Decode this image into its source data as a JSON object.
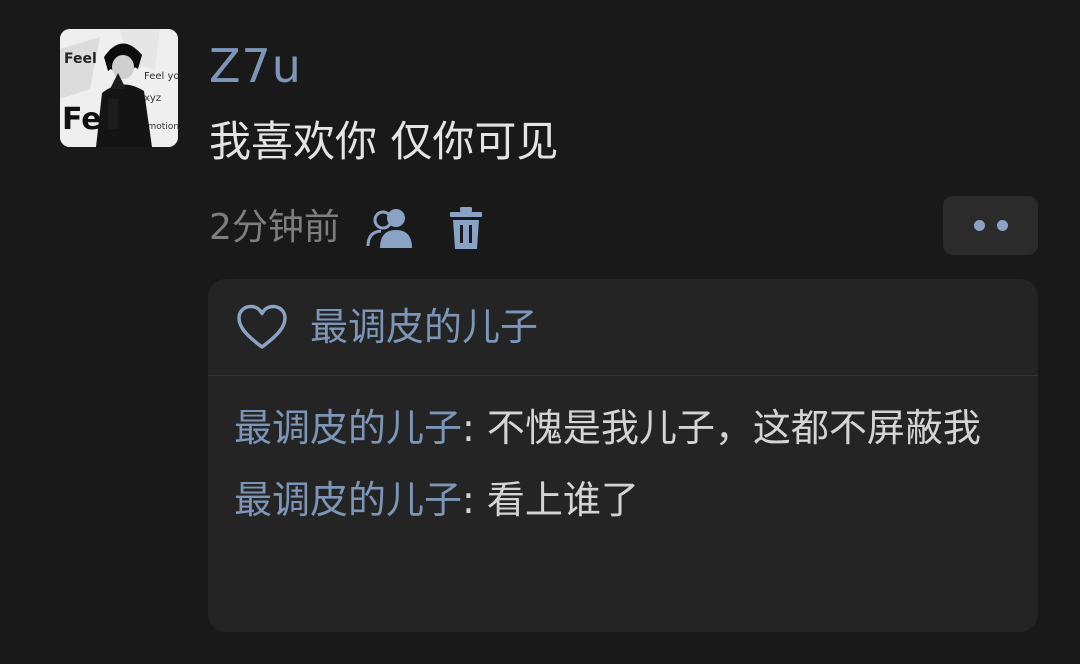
{
  "post": {
    "avatar_icon": "user-avatar-image",
    "username": "Z7u",
    "text": "我喜欢你 仅你可见",
    "timestamp": "2分钟前",
    "visibility_icon": "group-visibility-icon",
    "delete_icon": "trash-icon",
    "more_icon": "more-dots-icon"
  },
  "likes": {
    "icon": "heart-outline-icon",
    "names": "最调皮的儿子"
  },
  "comments": [
    {
      "author": "最调皮的儿子",
      "separator": ": ",
      "text": "不愧是我儿子，这都不屏蔽我"
    },
    {
      "author": "最调皮的儿子",
      "separator": ": ",
      "text": "看上谁了"
    }
  ],
  "colors": {
    "background": "#191919",
    "panel": "#242424",
    "accent_name": "#7d96b8",
    "body_text": "#e4e4e4",
    "muted": "#7e7e7e"
  }
}
